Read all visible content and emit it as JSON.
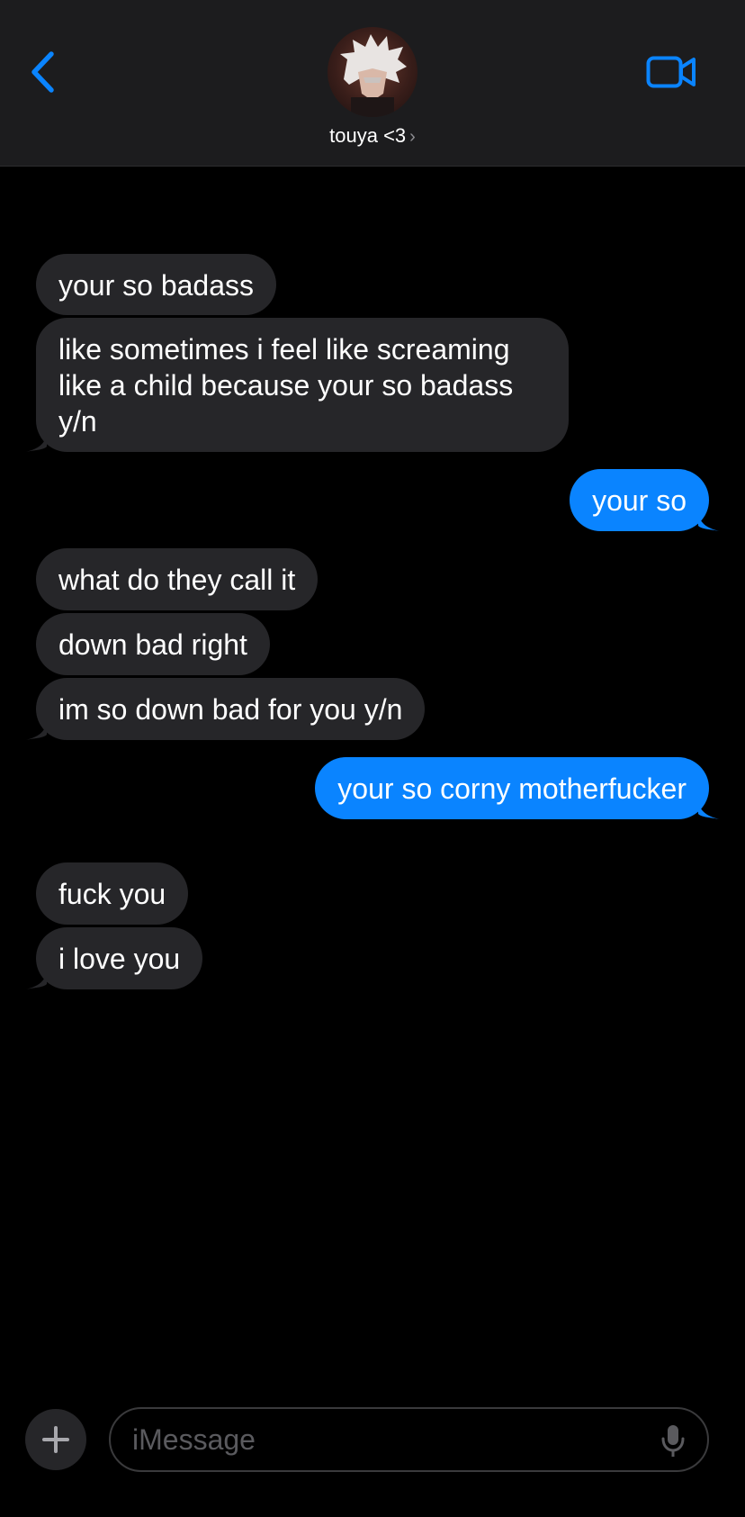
{
  "header": {
    "contact_name": "touya <3",
    "chevron": "›",
    "back_icon": "chevron-left-icon",
    "video_icon": "video-camera-icon"
  },
  "colors": {
    "accent": "#0a84ff",
    "incoming_bubble": "#262629",
    "header_bg": "#1c1c1e"
  },
  "messages": [
    {
      "sender": "them",
      "text": "your so badass"
    },
    {
      "sender": "them",
      "text": "like sometimes i feel like screaming like a child because your so badass y/n"
    },
    {
      "sender": "me",
      "text": "your so"
    },
    {
      "sender": "them",
      "text": "what do they call it"
    },
    {
      "sender": "them",
      "text": "down bad right"
    },
    {
      "sender": "them",
      "text": "im so down bad for you y/n"
    },
    {
      "sender": "me",
      "text": "your so corny motherfucker"
    },
    {
      "sender": "them",
      "text": "fuck you"
    },
    {
      "sender": "them",
      "text": "i love you"
    }
  ],
  "composer": {
    "placeholder": "iMessage",
    "plus_icon": "plus-icon",
    "mic_icon": "microphone-icon"
  }
}
